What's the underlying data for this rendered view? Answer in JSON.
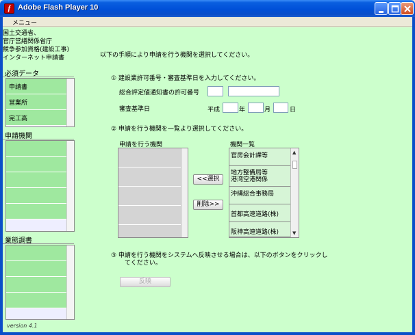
{
  "window": {
    "title": "Adobe Flash Player 10",
    "icon_glyph": "f"
  },
  "menu": {
    "items": [
      "メニュー"
    ]
  },
  "sidebar": {
    "app_name_lines": [
      "国土交通省、",
      "官庁営繕関係省庁",
      "競争参加資格(建設工事)",
      "インターネット申請書"
    ],
    "required_section": {
      "label": "必須データ",
      "items": [
        "申請書",
        "営業所",
        "完工高"
      ]
    },
    "apply_section": {
      "label": "申請機関"
    },
    "survey_section": {
      "label": "業態調書"
    },
    "version": "version 4.1"
  },
  "main": {
    "instruction": "以下の手順により申請を行う機関を選択してください。",
    "step1": {
      "label": "①  建設業許可番号・審査基準日を入力してください。",
      "license_label": "総合評定値通知書の許可番号",
      "license_value1": "",
      "license_value2": "",
      "date_label": "審査基準日",
      "era": "平成",
      "year_unit": "年",
      "month_unit": "月",
      "day_unit": "日",
      "year_value": "",
      "month_value": "",
      "day_value": ""
    },
    "step2": {
      "label": "②  申請を行う機関を一覧より選択してください。",
      "left_list_label": "申請を行う機関",
      "right_list_label": "機関一覧",
      "agencies": [
        "官房会計課等",
        "地方整備局等",
        "港湾空港関係",
        "沖縄総合事務局",
        "首都高速道路(株)",
        "阪神高速道路(株)"
      ],
      "select_button": "<<選択",
      "remove_button": "削除>>"
    },
    "step3": {
      "label_line1": "③  申請を行う機関をシステムへ反映させる場合は、以下のボタンをクリックし",
      "label_line2": "てください。",
      "apply_button": "反映"
    }
  },
  "colors": {
    "title_bar": "#0050d8",
    "content_bg": "#ccffcc",
    "list_item_bg": "#9fe89f"
  }
}
